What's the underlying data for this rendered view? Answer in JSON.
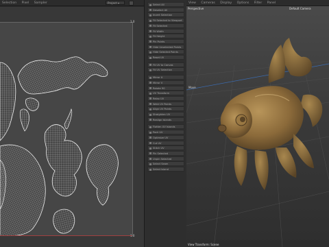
{
  "uv_editor": {
    "menu": [
      "Selection",
      "Pixel",
      "Sampler"
    ],
    "dropdown_value": "Project",
    "axis_top": "1.0",
    "axis_bottom": "1.0"
  },
  "command_list": {
    "items": [
      "Select All",
      "Deselect All",
      "Invert Selection",
      "Fit Selected to Viewport",
      "Fit Selected",
      "Fit Width",
      "Fit Height",
      "Pin Points",
      "Hide Unselected Points",
      "Hide Selected Points",
      "Reset UV",
      "Fit UV to Canvas",
      "Fit UV Selection",
      "Mirror U",
      "Mirror V",
      "Rotate 90",
      "UV Transform",
      "Relax UV",
      "Weld UV Points",
      "Align UV Points",
      "Straighten UV",
      "Realign Islands",
      "Flatten UV Islands",
      "Pack UV",
      "Optimize UV",
      "Cut UV",
      "Stitch UV",
      "Pin Selected",
      "Unpin Selected",
      "Select Seam",
      "Select Island"
    ]
  },
  "viewport": {
    "menu": [
      "View",
      "Cameras",
      "Display",
      "Options",
      "Filter",
      "Panel"
    ],
    "view_name": "Perspective",
    "camera_name": "Default Camera",
    "status": "Move",
    "footer": "View Transform: Scene"
  },
  "colors": {
    "wireframe": "#e8e8e8",
    "fish_body": "#8b6a3a",
    "baseline": "#a04040"
  }
}
